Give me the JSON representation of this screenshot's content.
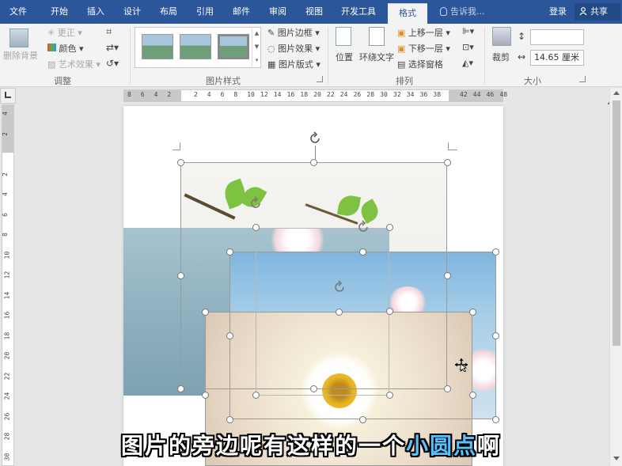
{
  "tabs": [
    {
      "label": "文件",
      "active": false
    },
    {
      "label": "开始",
      "active": false
    },
    {
      "label": "插入",
      "active": false
    },
    {
      "label": "设计",
      "active": false
    },
    {
      "label": "布局",
      "active": false
    },
    {
      "label": "引用",
      "active": false
    },
    {
      "label": "邮件",
      "active": false
    },
    {
      "label": "审阅",
      "active": false
    },
    {
      "label": "视图",
      "active": false
    },
    {
      "label": "开发工具",
      "active": false
    },
    {
      "label": "格式",
      "active": true
    }
  ],
  "tell_me": "告诉我...",
  "login": "登录",
  "share": "共享",
  "ribbon": {
    "adjust": {
      "remove_bg": "删除背景",
      "corrections": "更正",
      "color": "颜色",
      "artistic": "艺术效果",
      "group": "调整"
    },
    "styles": {
      "border": "图片边框",
      "effects": "图片效果",
      "layout": "图片版式",
      "group": "图片样式"
    },
    "arrange": {
      "position": "位置",
      "wrap": "环绕文字",
      "forward": "上移一层",
      "backward": "下移一层",
      "selection_pane": "选择窗格",
      "group": "排列"
    },
    "size": {
      "crop": "裁剪",
      "height": "",
      "width": "14.65 厘米",
      "group": "大小"
    }
  },
  "ruler": {
    "h_ticks": [
      "8",
      "6",
      "4",
      "2",
      "",
      "2",
      "4",
      "6",
      "8",
      "10",
      "12",
      "14",
      "16",
      "18",
      "20",
      "22",
      "24",
      "26",
      "28",
      "30",
      "32",
      "34",
      "36",
      "38",
      "",
      "42",
      "44",
      "46",
      "48"
    ],
    "v_ticks": [
      "4",
      "2",
      "",
      "2",
      "4",
      "6",
      "8",
      "10",
      "12",
      "14",
      "16",
      "18",
      "20",
      "22",
      "24",
      "26",
      "28",
      "30"
    ]
  },
  "subtitle": {
    "text_before": "图片的旁边呢有这样的一个",
    "highlight": "小圆点",
    "text_after": "啊"
  },
  "colors": {
    "title_bar": "#2b579a",
    "subtitle_highlight": "#55c2ff"
  }
}
